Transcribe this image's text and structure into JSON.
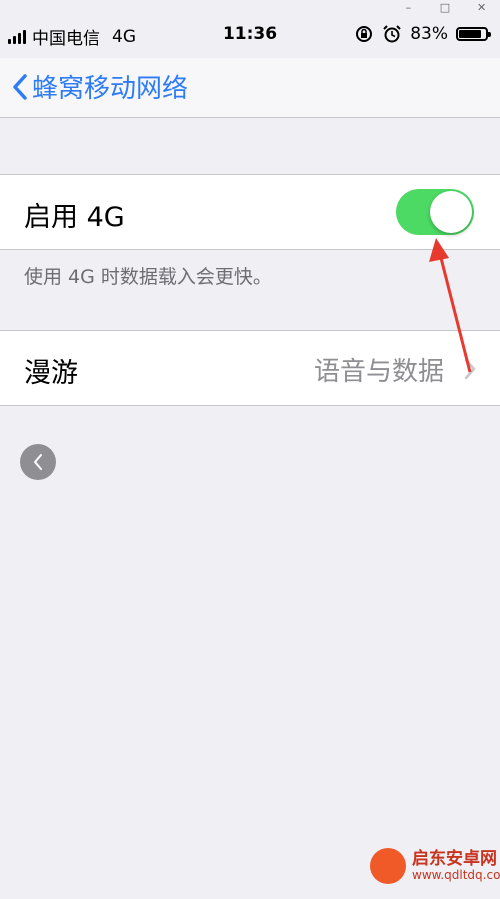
{
  "window": {
    "min_icon": "minimize-icon",
    "max_icon": "maximize-icon",
    "close_icon": "close-icon"
  },
  "status_bar": {
    "carrier": "中国电信",
    "network": "4G",
    "time": "11:36",
    "battery_percent": "83%",
    "battery_level": 0.83,
    "icons": [
      "signal-icon",
      "rotation-lock-icon",
      "alarm-icon",
      "battery-icon"
    ]
  },
  "nav": {
    "back_label": "蜂窝移动网络"
  },
  "enable_4g": {
    "label": "启用 4G",
    "enabled": true,
    "toggle_color": "#4cd964"
  },
  "footnote": "使用 4G 时数据载入会更快。",
  "roaming": {
    "label": "漫游",
    "value": "语音与数据"
  },
  "annotation": {
    "arrow_color": "#e8392f"
  },
  "watermark": {
    "title": "启东安卓网",
    "url": "www.qdltdq.com"
  },
  "colors": {
    "accent": "#2d7cf6",
    "background": "#efeff4"
  }
}
